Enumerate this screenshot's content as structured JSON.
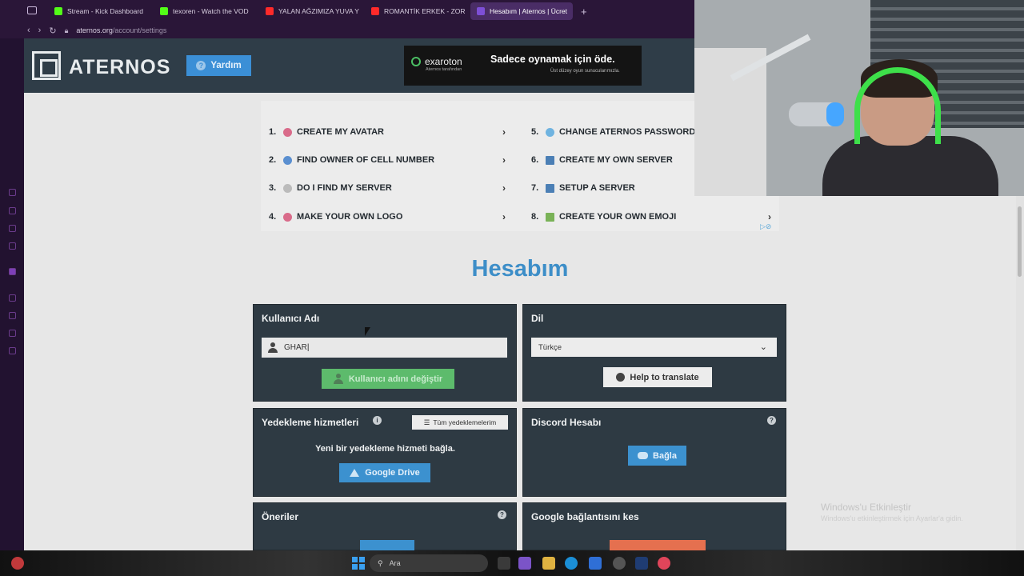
{
  "browser": {
    "tabs": [
      {
        "label": "Stream - Kick Dashboard",
        "color": "#53fc18"
      },
      {
        "label": "texoren - Watch the VOD",
        "color": "#53fc18"
      },
      {
        "label": "YALAN AĞZIMIZA YUVA Y",
        "color": "#ff2a2a"
      },
      {
        "label": "ROMANTİK ERKEK - ZOR",
        "color": "#ff2a2a"
      },
      {
        "label": "Hesabım | Aternos | Ücret",
        "color": "#7d4fd6"
      }
    ],
    "new_tab": "+",
    "url_host": "aternos.org",
    "url_path": "/account/settings"
  },
  "header": {
    "logo_text": "ATERNOS",
    "help_label": "Yardım",
    "ad": {
      "brand": "exaroton",
      "brand_sub": "Aternos tarafından",
      "slogan": "Sadece oynamak için öde.",
      "slogan_sub": "Üst düzey oyun sunucularımızla."
    }
  },
  "ad_list": [
    {
      "num": "1.",
      "label": "CREATE MY AVATAR",
      "icon_color": "#d96b8a",
      "chevron": "›"
    },
    {
      "num": "2.",
      "label": "FIND OWNER OF CELL NUMBER",
      "icon_color": "#5a8fd0",
      "chevron": "›"
    },
    {
      "num": "3.",
      "label": "DO I FIND MY SERVER",
      "icon_color": "#bbbbbb",
      "chevron": "›"
    },
    {
      "num": "4.",
      "label": "MAKE YOUR OWN LOGO",
      "icon_color": "#d96b8a",
      "chevron": "›"
    },
    {
      "num": "5.",
      "label": "CHANGE ATERNOS PASSWORD",
      "icon_color": "#6fb3e0",
      "chevron": ""
    },
    {
      "num": "6.",
      "label": "CREATE MY OWN SERVER",
      "icon_color": "#4b7fb5",
      "chevron": ""
    },
    {
      "num": "7.",
      "label": "SETUP A SERVER",
      "icon_color": "#4b7fb5",
      "chevron": ""
    },
    {
      "num": "8.",
      "label": "CREATE YOUR OWN EMOJI",
      "icon_color": "#79b257",
      "chevron": "›"
    }
  ],
  "ad_choices": "▷⊘",
  "page": {
    "title": "Hesabım",
    "username_card": {
      "title": "Kullanıcı Adı",
      "value": "GHAR",
      "button": "Kullanıcı adını değiştir"
    },
    "language_card": {
      "title": "Dil",
      "selected": "Türkçe",
      "translate_button": "Help to translate"
    },
    "backup_card": {
      "title": "Yedekleme hizmetleri",
      "all_button": "Tüm yedeklemelerim",
      "text": "Yeni bir yedekleme hizmeti bağla.",
      "gdrive_button": "Google Drive"
    },
    "discord_card": {
      "title": "Discord Hesabı",
      "connect_button": "Bağla"
    },
    "suggest_card": {
      "title": "Öneriler"
    },
    "google_card": {
      "title": "Google bağlantısını kes"
    }
  },
  "windows_watermark": {
    "line1": "Windows'u Etkinleştir",
    "line2": "Windows'u etkinleştirmek için Ayarlar'a gidin."
  },
  "taskbar": {
    "search_placeholder": "Ara"
  }
}
